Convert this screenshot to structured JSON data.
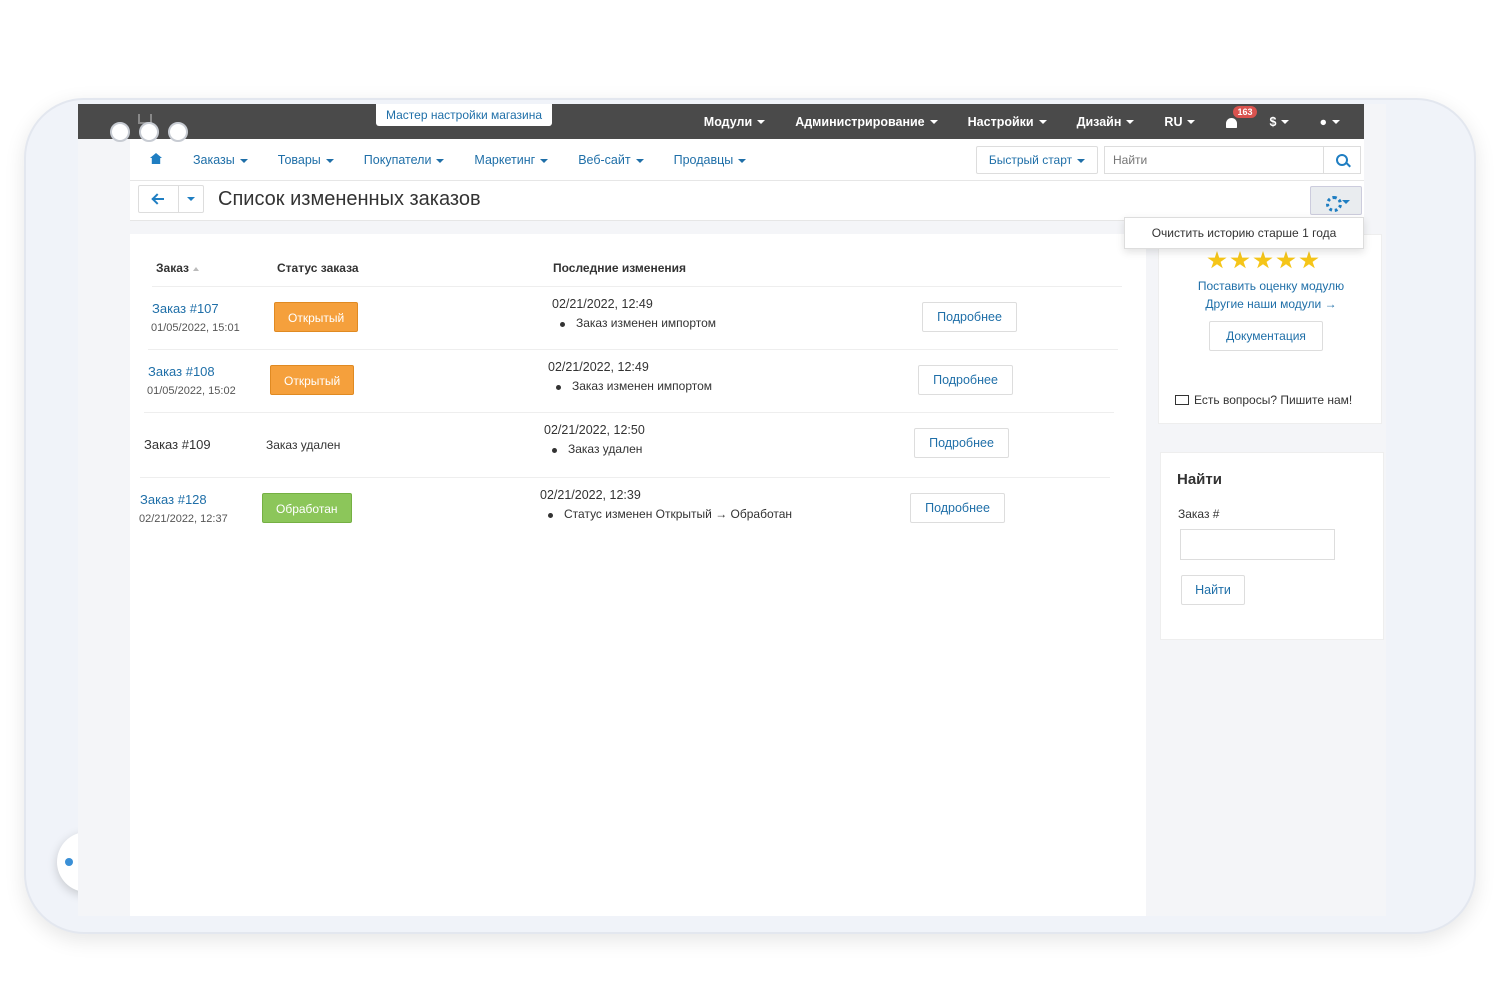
{
  "topbar": {
    "wizard": "Мастер настройки магазина",
    "menu": [
      "Модули",
      "Администрирование",
      "Настройки",
      "Дизайн",
      "RU"
    ],
    "notifications_count": "163",
    "currency": "$"
  },
  "subnav": {
    "items": [
      "Заказы",
      "Товары",
      "Покупатели",
      "Маркетинг",
      "Веб-сайт",
      "Продавцы"
    ],
    "quick_start": "Быстрый старт",
    "search_placeholder": "Найти"
  },
  "page": {
    "title": "Список измененных заказов",
    "dropdown_item": "Очистить историю старше 1 года"
  },
  "table": {
    "headers": {
      "order": "Заказ",
      "status": "Статус заказа",
      "changes": "Последние изменения"
    },
    "rows": [
      {
        "order": "Заказ #107",
        "order_date": "01/05/2022, 15:01",
        "status": "Открытый",
        "change_date": "02/21/2022, 12:49",
        "change": "Заказ изменен импортом",
        "action": "Подробнее"
      },
      {
        "order": "Заказ #108",
        "order_date": "01/05/2022, 15:02",
        "status": "Открытый",
        "change_date": "02/21/2022, 12:49",
        "change": "Заказ изменен импортом",
        "action": "Подробнее"
      },
      {
        "order": "Заказ #109",
        "order_date": "",
        "status": "Заказ удален",
        "change_date": "02/21/2022, 12:50",
        "change": "Заказ удален",
        "action": "Подробнее"
      },
      {
        "order": "Заказ #128",
        "order_date": "02/21/2022, 12:37",
        "status": "Обработан",
        "change_date": "02/21/2022, 12:39",
        "change": "Статус изменен Открытый → Обработан",
        "action": "Подробнее"
      }
    ]
  },
  "sidebar": {
    "rate_module": "Поставить оценку модулю",
    "other_modules": "Другие наши модули →",
    "documentation": "Документация",
    "contact": "Есть вопросы? Пишите нам!",
    "find": {
      "heading": "Найти",
      "label": "Заказ #",
      "button": "Найти"
    }
  },
  "colors": {
    "status_open": "#f5a03c",
    "status_done": "#8cc65a",
    "link": "#1f6fa8",
    "topbar": "#4a4a4a"
  }
}
